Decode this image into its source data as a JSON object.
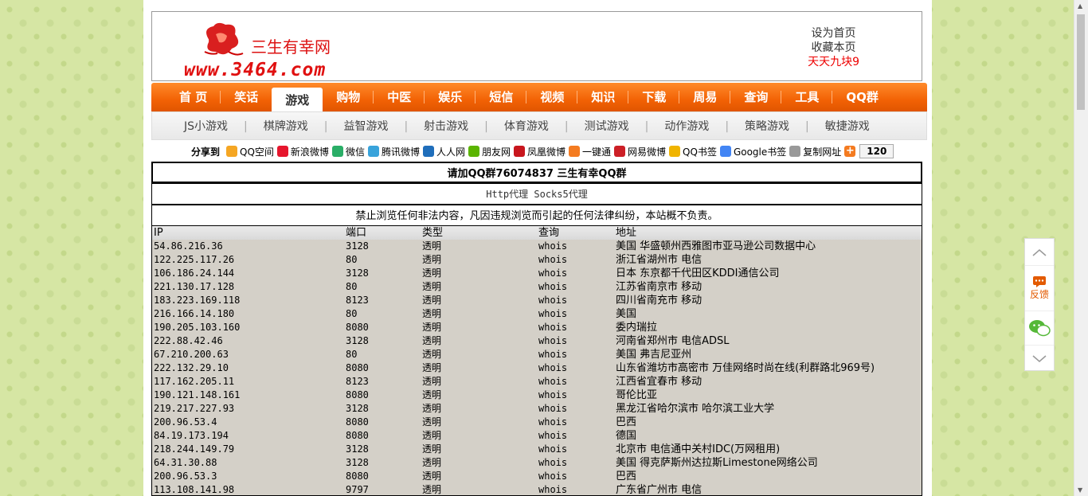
{
  "site": {
    "name": "三生有幸网",
    "url_logo": "www.3464.com",
    "links": [
      "设为首页",
      "收藏本页",
      "天天九块9"
    ]
  },
  "nav": {
    "items": [
      "首 页",
      "笑话",
      "游戏",
      "购物",
      "中医",
      "娱乐",
      "短信",
      "视频",
      "知识",
      "下载",
      "周易",
      "查询",
      "工具",
      "QQ群"
    ],
    "active": "游戏"
  },
  "subnav": [
    "JS小游戏",
    "棋牌游戏",
    "益智游戏",
    "射击游戏",
    "体育游戏",
    "测试游戏",
    "动作游戏",
    "策略游戏",
    "敏捷游戏"
  ],
  "share": {
    "label": "分享到",
    "items": [
      {
        "label": "QQ空间",
        "color": "#f5a623"
      },
      {
        "label": "新浪微博",
        "color": "#e6162d"
      },
      {
        "label": "微信",
        "color": "#2aae67"
      },
      {
        "label": "腾讯微博",
        "color": "#38a3db"
      },
      {
        "label": "人人网",
        "color": "#1f6ebb"
      },
      {
        "label": "朋友网",
        "color": "#5ab400"
      },
      {
        "label": "凤凰微博",
        "color": "#c8161d"
      },
      {
        "label": "一键通",
        "color": "#f47b20"
      },
      {
        "label": "网易微博",
        "color": "#cc1f26"
      },
      {
        "label": "QQ书签",
        "color": "#f0b400"
      },
      {
        "label": "Google书签",
        "color": "#4285f4"
      },
      {
        "label": "复制网址",
        "color": "#999999"
      }
    ],
    "count": "120"
  },
  "notice": {
    "qq_group": "请加QQ群76074837 三生有幸QQ群",
    "proxy_title": "Http代理 Socks5代理",
    "disclaimer": "禁止浏览任何非法内容，凡因违规浏览而引起的任何法律纠纷，本站概不负责。"
  },
  "table": {
    "headers": [
      "IP",
      "端口",
      "类型",
      "查询",
      "地址"
    ],
    "rows": [
      [
        "54.86.216.36",
        "3128",
        "透明",
        "whois",
        "美国 华盛顿州西雅图市亚马逊公司数据中心"
      ],
      [
        "122.225.117.26",
        "80",
        "透明",
        "whois",
        "浙江省湖州市 电信"
      ],
      [
        "106.186.24.144",
        "3128",
        "透明",
        "whois",
        "日本 东京都千代田区KDDI通信公司"
      ],
      [
        "221.130.17.128",
        "80",
        "透明",
        "whois",
        "江苏省南京市 移动"
      ],
      [
        "183.223.169.118",
        "8123",
        "透明",
        "whois",
        "四川省南充市 移动"
      ],
      [
        "216.166.14.180",
        "80",
        "透明",
        "whois",
        "美国"
      ],
      [
        "190.205.103.160",
        "8080",
        "透明",
        "whois",
        "委内瑞拉"
      ],
      [
        "222.88.42.46",
        "3128",
        "透明",
        "whois",
        "河南省郑州市 电信ADSL"
      ],
      [
        "67.210.200.63",
        "80",
        "透明",
        "whois",
        "美国 弗吉尼亚州"
      ],
      [
        "222.132.29.10",
        "8080",
        "透明",
        "whois",
        "山东省潍坊市高密市 万佳网络时尚在线(利群路北969号)"
      ],
      [
        "117.162.205.11",
        "8123",
        "透明",
        "whois",
        "江西省宜春市 移动"
      ],
      [
        "190.121.148.161",
        "8080",
        "透明",
        "whois",
        "哥伦比亚"
      ],
      [
        "219.217.227.93",
        "3128",
        "透明",
        "whois",
        "黑龙江省哈尔滨市 哈尔滨工业大学"
      ],
      [
        "200.96.53.4",
        "8080",
        "透明",
        "whois",
        "巴西"
      ],
      [
        "84.19.173.194",
        "8080",
        "透明",
        "whois",
        "德国"
      ],
      [
        "218.244.149.79",
        "3128",
        "透明",
        "whois",
        "北京市 电信通中关村IDC(万网租用)"
      ],
      [
        "64.31.30.88",
        "3128",
        "透明",
        "whois",
        "美国 得克萨斯州达拉斯Limestone网络公司"
      ],
      [
        "200.96.53.3",
        "8080",
        "透明",
        "whois",
        "巴西"
      ],
      [
        "113.108.141.98",
        "9797",
        "透明",
        "whois",
        "广东省广州市 电信"
      ]
    ]
  },
  "side": {
    "feedback": "反馈"
  }
}
